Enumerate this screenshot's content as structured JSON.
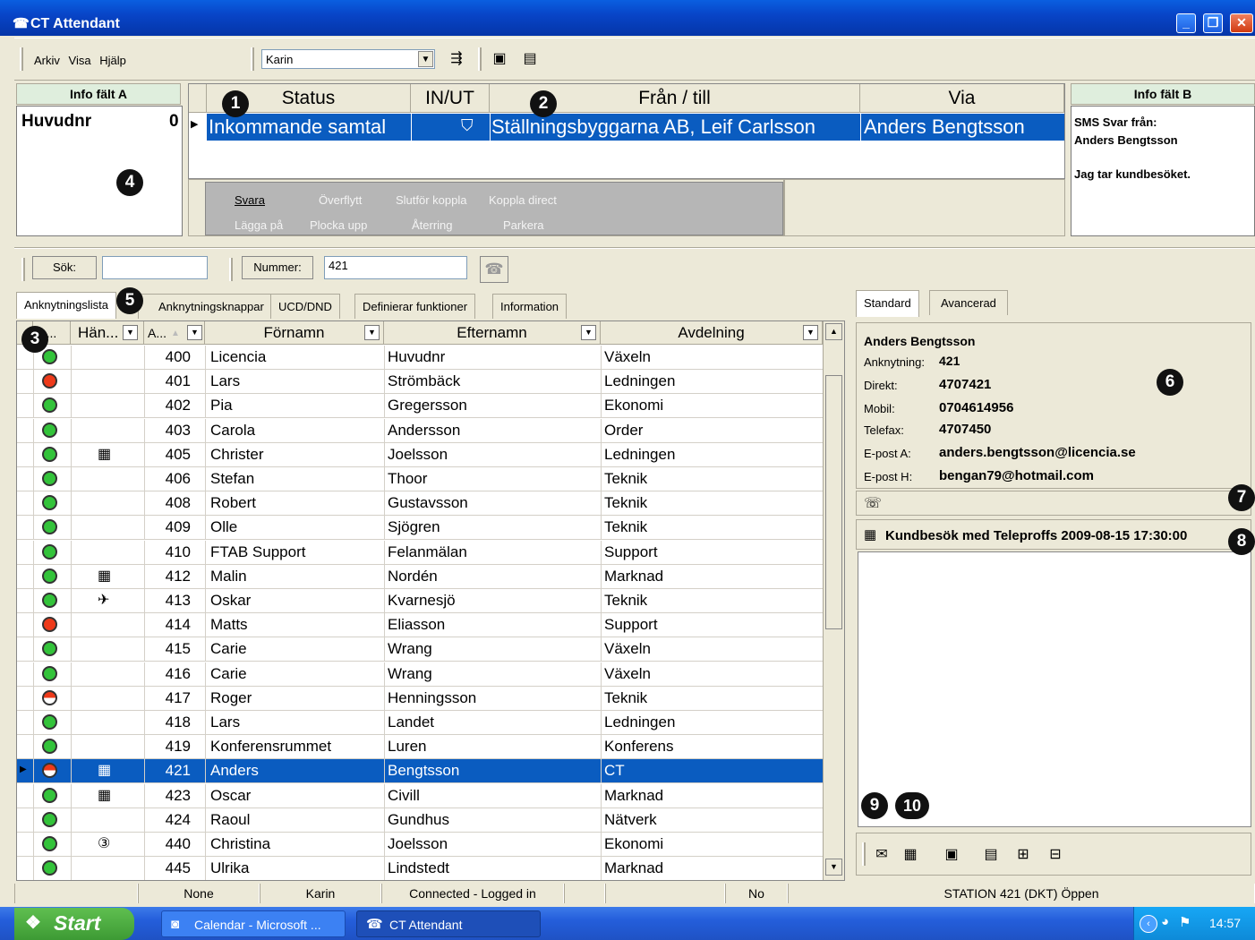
{
  "window": {
    "title": "CT Attendant"
  },
  "menu": {
    "items": [
      "Arkiv",
      "Visa",
      "Hjälp"
    ]
  },
  "toolbar": {
    "user_value": "Karin"
  },
  "info_a": {
    "title": "Info fält A",
    "label": "Huvudnr",
    "count": "0"
  },
  "info_b": {
    "title": "Info fält B",
    "line1": "SMS Svar från:",
    "line2": "Anders Bengtsson",
    "line3": "Jag tar kundbesöket."
  },
  "call_grid": {
    "headers": {
      "status": "Status",
      "inout": "IN/UT",
      "from_to": "Från / till",
      "via": "Via"
    },
    "row": {
      "status": "Inkommande samtal",
      "from_to": "Ställningsbyggarna AB, Leif Carlsson",
      "via": "Anders Bengtsson"
    }
  },
  "actions": {
    "row1": [
      "Svara",
      "Överflytt",
      "Slutför koppla",
      "Koppla direct"
    ],
    "row2": [
      "Lägga på",
      "Plocka upp",
      "Återring",
      "Parkera"
    ]
  },
  "search": {
    "button": "Sök:",
    "value": "",
    "number_label": "Nummer:",
    "number_value": "421"
  },
  "tabs": [
    "Anknytningslista",
    "Anknytningsknappar",
    "UCD/DND",
    "Definierar funktioner",
    "Information"
  ],
  "right_tabs": [
    "Standard",
    "Avancerad"
  ],
  "grid": {
    "headers": {
      "status": "...",
      "event": "Hän...",
      "ext": "A...",
      "first": "Förnamn",
      "last": "Efternamn",
      "dept": "Avdelning"
    },
    "rows": [
      {
        "s": "green",
        "icon": "",
        "ext": "400",
        "first": "Licencia",
        "last": "Huvudnr",
        "dept": "Växeln"
      },
      {
        "s": "red",
        "icon": "",
        "ext": "401",
        "first": "Lars",
        "last": "Strömbäck",
        "dept": "Ledningen"
      },
      {
        "s": "green",
        "icon": "",
        "ext": "402",
        "first": "Pia",
        "last": "Gregersson",
        "dept": "Ekonomi"
      },
      {
        "s": "green",
        "icon": "",
        "ext": "403",
        "first": "Carola",
        "last": "Andersson",
        "dept": "Order"
      },
      {
        "s": "green",
        "icon": "calendar",
        "ext": "405",
        "first": "Christer",
        "last": "Joelsson",
        "dept": "Ledningen"
      },
      {
        "s": "green",
        "icon": "",
        "ext": "406",
        "first": "Stefan",
        "last": "Thoor",
        "dept": "Teknik"
      },
      {
        "s": "green",
        "icon": "",
        "ext": "408",
        "first": "Robert",
        "last": "Gustavsson",
        "dept": "Teknik"
      },
      {
        "s": "green",
        "icon": "",
        "ext": "409",
        "first": "Olle",
        "last": "Sjögren",
        "dept": "Teknik"
      },
      {
        "s": "green",
        "icon": "",
        "ext": "410",
        "first": "FTAB Support",
        "last": "Felanmälan",
        "dept": "Support"
      },
      {
        "s": "green",
        "icon": "calendar",
        "ext": "412",
        "first": "Malin",
        "last": "Nordén",
        "dept": "Marknad"
      },
      {
        "s": "green",
        "icon": "plane",
        "ext": "413",
        "first": "Oskar",
        "last": "Kvarnesjö",
        "dept": "Teknik"
      },
      {
        "s": "red",
        "icon": "",
        "ext": "414",
        "first": "Matts",
        "last": "Eliasson",
        "dept": "Support"
      },
      {
        "s": "green",
        "icon": "",
        "ext": "415",
        "first": "Carie",
        "last": "Wrang",
        "dept": "Växeln"
      },
      {
        "s": "green",
        "icon": "",
        "ext": "416",
        "first": "Carie",
        "last": "Wrang",
        "dept": "Växeln"
      },
      {
        "s": "half",
        "icon": "",
        "ext": "417",
        "first": "Roger",
        "last": "Henningsson",
        "dept": "Teknik"
      },
      {
        "s": "green",
        "icon": "",
        "ext": "418",
        "first": "Lars",
        "last": "Landet",
        "dept": "Ledningen"
      },
      {
        "s": "green",
        "icon": "",
        "ext": "419",
        "first": "Konferensrummet",
        "last": "Luren",
        "dept": "Konferens"
      },
      {
        "s": "half",
        "icon": "calendar",
        "ext": "421",
        "first": "Anders",
        "last": "Bengtsson",
        "dept": "CT",
        "selected": true
      },
      {
        "s": "green",
        "icon": "calendar",
        "ext": "423",
        "first": "Oscar",
        "last": "Civill",
        "dept": "Marknad"
      },
      {
        "s": "green",
        "icon": "",
        "ext": "424",
        "first": "Raoul",
        "last": "Gundhus",
        "dept": "Nätverk"
      },
      {
        "s": "green",
        "icon": "day3",
        "ext": "440",
        "first": "Christina",
        "last": "Joelsson",
        "dept": "Ekonomi"
      },
      {
        "s": "green",
        "icon": "",
        "ext": "445",
        "first": "Ulrika",
        "last": "Lindstedt",
        "dept": "Marknad"
      }
    ]
  },
  "details": {
    "name": "Anders Bengtsson",
    "ext_label": "Anknytning:",
    "ext": "421",
    "direct_label": "Direkt:",
    "direct": "4707421",
    "mobile_label": "Mobil:",
    "mobile": "0704614956",
    "fax_label": "Telefax:",
    "fax": "4707450",
    "email_a_label": "E-post A:",
    "email_a": "anders.bengtsson@licencia.se",
    "email_h_label": "E-post H:",
    "email_h": "bengan79@hotmail.com"
  },
  "appointment": "Kundbesök med Teleproffs  2009-08-15 17:30:00",
  "badges": [
    "1",
    "2",
    "3",
    "4",
    "5",
    "6",
    "7",
    "8",
    "9",
    "10"
  ],
  "statusbar": [
    "None",
    "Karin",
    "Connected - Logged in",
    "No",
    "STATION  421 (DKT) Öppen"
  ],
  "taskbar": {
    "start": "Start",
    "task1": "Calendar - Microsoft ...",
    "task2": "CT Attendant",
    "clock": "14:57"
  },
  "colors": {
    "title_blue": "#0845c8",
    "selection": "#0a5cc0",
    "status_green": "#33c33a",
    "status_red": "#ee3a1a",
    "info_head": "#dfeedd"
  }
}
